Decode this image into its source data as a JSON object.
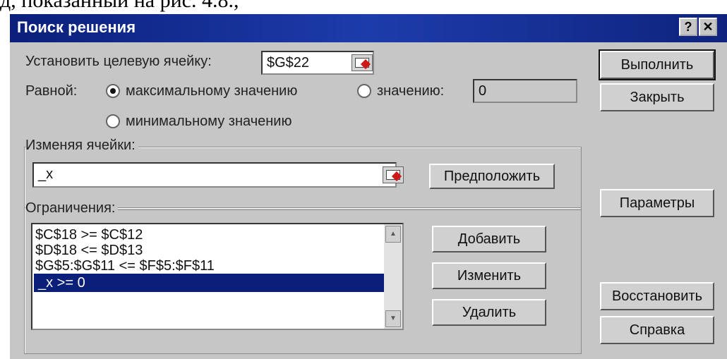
{
  "caption": "д, показанный на рис. 4.8.,",
  "window": {
    "title": "Поиск решения",
    "help_glyph": "?",
    "close_glyph": "✕"
  },
  "target": {
    "label": "Установить целевую ячейку:",
    "value": "$G$22"
  },
  "equal": {
    "label": "Равной:",
    "options": [
      {
        "label": "максимальному значению",
        "selected": true
      },
      {
        "label": "значению:",
        "selected": false
      },
      {
        "label": "минимальному значению",
        "selected": false
      }
    ],
    "value_field": "0"
  },
  "changing": {
    "label": "Изменяя ячейки:",
    "value": "_x",
    "guess_button": "Предположить"
  },
  "constraints": {
    "label": "Ограничения:",
    "items": [
      {
        "text": "$C$18 >= $C$12",
        "selected": false
      },
      {
        "text": "$D$18 <= $D$13",
        "selected": false
      },
      {
        "text": "$G$5:$G$11 <= $F$5:$F$11",
        "selected": false
      },
      {
        "text": "_x >= 0",
        "selected": true
      }
    ],
    "add_button": "Добавить",
    "change_button": "Изменить",
    "delete_button": "Удалить"
  },
  "side_buttons": {
    "solve": "Выполнить",
    "close": "Закрыть",
    "options": "Параметры",
    "reset": "Восстановить",
    "help": "Справка"
  },
  "colors": {
    "titlebar": "#0a1f7a",
    "dialog_bg": "#c6c6c6",
    "selection": "#0a1f7a"
  }
}
